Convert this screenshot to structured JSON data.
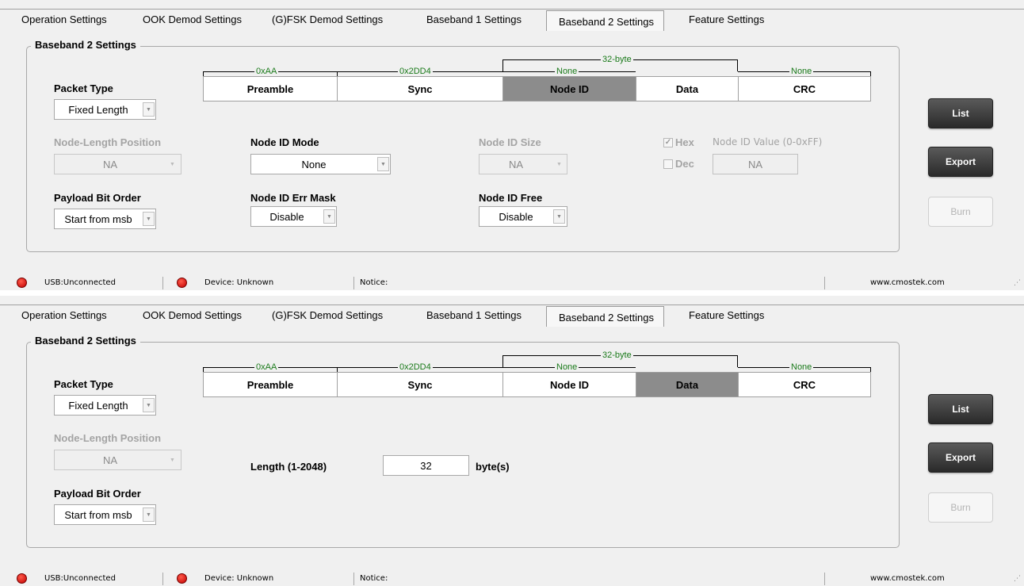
{
  "tabs": [
    "Operation Settings",
    "OOK Demod Settings",
    "(G)FSK Demod Settings",
    "Baseband 1 Settings",
    "Baseband 2 Settings",
    "Feature Settings"
  ],
  "group_title": "Baseband 2 Settings",
  "frame": {
    "fields": [
      "Preamble",
      "Sync",
      "Node ID",
      "Data",
      "CRC"
    ],
    "values": {
      "preamble": "0xAA",
      "sync": "0x2DD4",
      "node_id": "None",
      "data_len": "32-byte",
      "crc": "None"
    }
  },
  "packet_type": {
    "label": "Packet Type",
    "value": "Fixed Length"
  },
  "node_length_position": {
    "label": "Node-Length Position",
    "value": "NA"
  },
  "payload_bit_order": {
    "label": "Payload Bit Order",
    "value": "Start from msb"
  },
  "panel1": {
    "node_id_mode": {
      "label": "Node ID Mode",
      "value": "None"
    },
    "node_id_size": {
      "label": "Node ID Size",
      "value": "NA"
    },
    "hex": {
      "label": "Hex",
      "checked": true
    },
    "dec": {
      "label": "Dec",
      "checked": false
    },
    "node_id_value": {
      "label": "Node ID Value (0-0xFF)",
      "value": "NA"
    },
    "node_id_err_mask": {
      "label": "Node ID Err Mask",
      "value": "Disable"
    },
    "node_id_free": {
      "label": "Node ID Free",
      "value": "Disable"
    }
  },
  "panel2": {
    "length": {
      "label": "Length (1-2048)",
      "value": "32",
      "unit": "byte(s)"
    }
  },
  "buttons": {
    "list": "List",
    "export": "Export",
    "burn": "Burn"
  },
  "status": {
    "usb": "USB:Unconnected",
    "device": "Device: Unknown",
    "notice": "Notice:",
    "website": "www.cmostek.com"
  },
  "colors": {
    "status_led": "#dd1a1a",
    "frame_value_text": "#1a7a1a",
    "selected_field": "#8c8c8c"
  }
}
